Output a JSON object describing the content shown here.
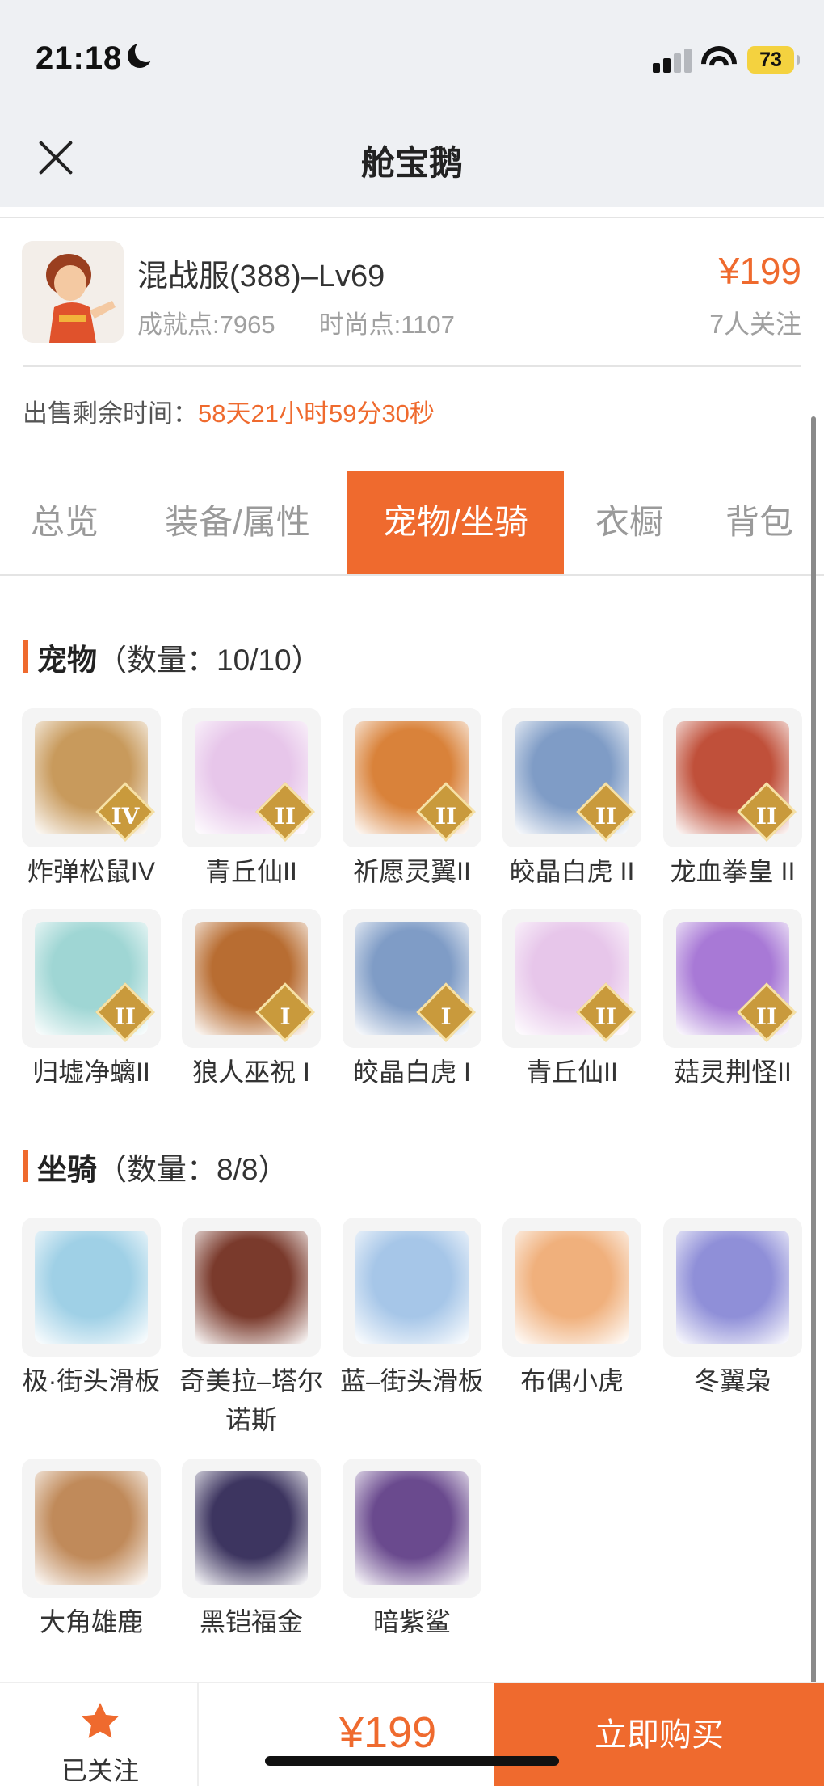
{
  "status_bar": {
    "time": "21:18",
    "battery": "73"
  },
  "nav": {
    "title": "舱宝鹅"
  },
  "product": {
    "name": "混战服(388)–Lv69",
    "achievement": "成就点:7965",
    "fashion": "时尚点:1107",
    "price": "¥199",
    "followers": "7人关注",
    "remaining_label": "出售剩余时间：",
    "remaining_value": "58天21小时59分30秒"
  },
  "tabs": [
    "总览",
    "装备/属性",
    "宠物/坐骑",
    "衣橱",
    "背包"
  ],
  "active_tab": "宠物/坐骑",
  "pets": {
    "title": "宠物",
    "count": "（数量：10/10）",
    "items": [
      {
        "name": "炸弹松鼠IV",
        "badge": "IV",
        "color": "#c89a5c"
      },
      {
        "name": "青丘仙II",
        "badge": "II",
        "color": "#e7c6ea"
      },
      {
        "name": "祈愿灵翼II",
        "badge": "II",
        "color": "#d9823a"
      },
      {
        "name": "皎晶白虎 II",
        "badge": "II",
        "color": "#7f9cc6"
      },
      {
        "name": "龙血拳皇 II",
        "badge": "II",
        "color": "#c0503a"
      },
      {
        "name": "归墟净螭II",
        "badge": "II",
        "color": "#9fd6d4"
      },
      {
        "name": "狼人巫祝 I",
        "badge": "I",
        "color": "#b86d32"
      },
      {
        "name": "皎晶白虎 I",
        "badge": "I",
        "color": "#7f9cc6"
      },
      {
        "name": "青丘仙II",
        "badge": "II",
        "color": "#e7c6ea"
      },
      {
        "name": "菇灵荆怪II",
        "badge": "II",
        "color": "#a879d6"
      }
    ]
  },
  "mounts": {
    "title": "坐骑",
    "count": "（数量：8/8）",
    "items": [
      {
        "name": "极·街头滑板",
        "color": "#9fd0e6"
      },
      {
        "name": "奇美拉–塔尔诺斯",
        "color": "#7a3a2c"
      },
      {
        "name": "蓝–街头滑板",
        "color": "#a6c6e8"
      },
      {
        "name": "布偶小虎",
        "color": "#f0b07c"
      },
      {
        "name": "冬翼枭",
        "color": "#8f8fd8"
      },
      {
        "name": "大角雄鹿",
        "color": "#c08a5a"
      },
      {
        "name": "黑铠福金",
        "color": "#3d3560"
      },
      {
        "name": "暗紫鲨",
        "color": "#6a4a8e"
      }
    ]
  },
  "bottom": {
    "follow_label": "已关注",
    "price": "¥199",
    "buy_label": "立即购买"
  },
  "colors": {
    "accent": "#ef6a2e",
    "badge": "#c99a3c"
  }
}
